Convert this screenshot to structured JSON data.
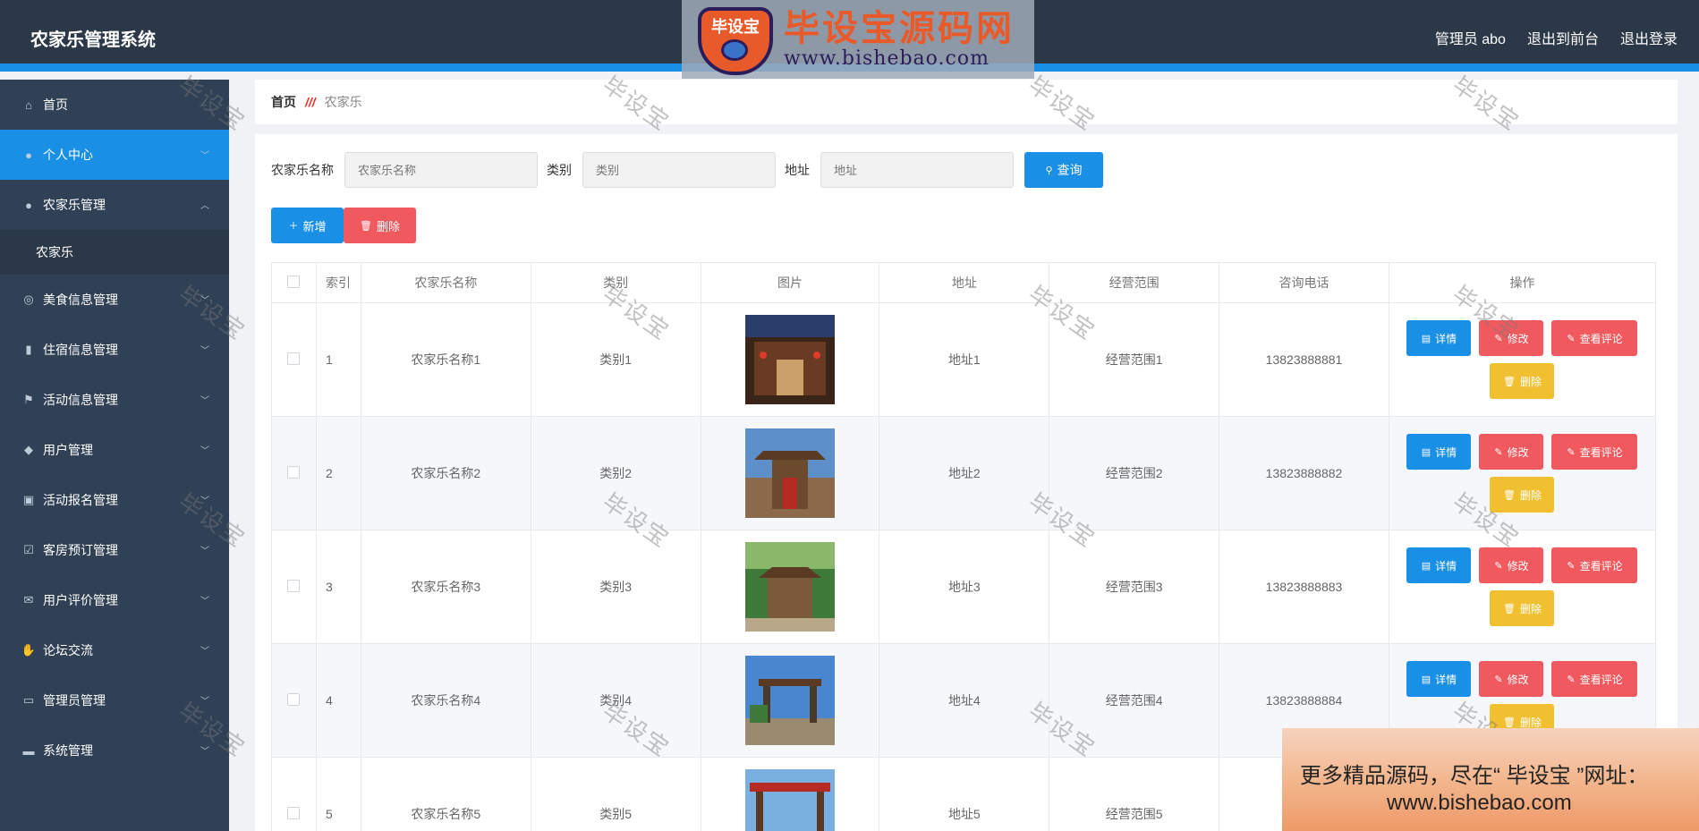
{
  "app": {
    "title": "农家乐管理系统"
  },
  "topnav": {
    "admin": "管理员 abo",
    "front": "退出到前台",
    "logout": "退出登录"
  },
  "logo_wm": {
    "badge": "毕设宝",
    "big": "毕设宝源码网",
    "small": "www.bishebao.com"
  },
  "sidebar": {
    "items": [
      {
        "label": "首页",
        "icon": "home-icon"
      },
      {
        "label": "个人中心",
        "icon": "user-icon"
      },
      {
        "label": "农家乐管理",
        "icon": "user-icon",
        "sub": "农家乐"
      },
      {
        "label": "美食信息管理",
        "icon": "compass-icon"
      },
      {
        "label": "住宿信息管理",
        "icon": "bars-icon"
      },
      {
        "label": "活动信息管理",
        "icon": "flag-icon"
      },
      {
        "label": "用户管理",
        "icon": "pin-icon"
      },
      {
        "label": "活动报名管理",
        "icon": "clipboard-icon"
      },
      {
        "label": "客房预订管理",
        "icon": "check-icon"
      },
      {
        "label": "用户评价管理",
        "icon": "mail-icon"
      },
      {
        "label": "论坛交流",
        "icon": "thumb-icon"
      },
      {
        "label": "管理员管理",
        "icon": "chat-icon"
      },
      {
        "label": "系统管理",
        "icon": "monitor-icon"
      }
    ]
  },
  "breadcrumb": {
    "home": "首页",
    "sep": "///",
    "current": "农家乐"
  },
  "filters": {
    "name_label": "农家乐名称",
    "name_placeholder": "农家乐名称",
    "type_label": "类别",
    "type_placeholder": "类别",
    "addr_label": "地址",
    "addr_placeholder": "地址",
    "query": "查询"
  },
  "actions": {
    "add": "新增",
    "delete": "删除"
  },
  "table": {
    "headers": [
      "索引",
      "农家乐名称",
      "类别",
      "图片",
      "地址",
      "经营范围",
      "咨询电话",
      "操作"
    ],
    "rows": [
      {
        "idx": "1",
        "name": "农家乐名称1",
        "type": "类别1",
        "addr": "地址1",
        "scope": "经营范围1",
        "phone": "13823888881"
      },
      {
        "idx": "2",
        "name": "农家乐名称2",
        "type": "类别2",
        "addr": "地址2",
        "scope": "经营范围2",
        "phone": "13823888882"
      },
      {
        "idx": "3",
        "name": "农家乐名称3",
        "type": "类别3",
        "addr": "地址3",
        "scope": "经营范围3",
        "phone": "13823888883"
      },
      {
        "idx": "4",
        "name": "农家乐名称4",
        "type": "类别4",
        "addr": "地址4",
        "scope": "经营范围4",
        "phone": "13823888884"
      },
      {
        "idx": "5",
        "name": "农家乐名称5",
        "type": "类别5",
        "addr": "地址5",
        "scope": "经营范围5",
        "phone": "138"
      }
    ],
    "ops": {
      "detail": "详情",
      "edit": "修改",
      "review": "查看评论",
      "delete": "删除"
    }
  },
  "watermark": "毕设宝",
  "ad": {
    "line1": "更多精品源码，尽在“ 毕设宝 ”网址：",
    "line2": "www.bishebao.com"
  },
  "colors": {
    "primary": "#1a8fe6",
    "danger": "#f05a5f",
    "warning": "#f0c030",
    "sidebar": "#304156",
    "topbar": "#2b3848"
  }
}
